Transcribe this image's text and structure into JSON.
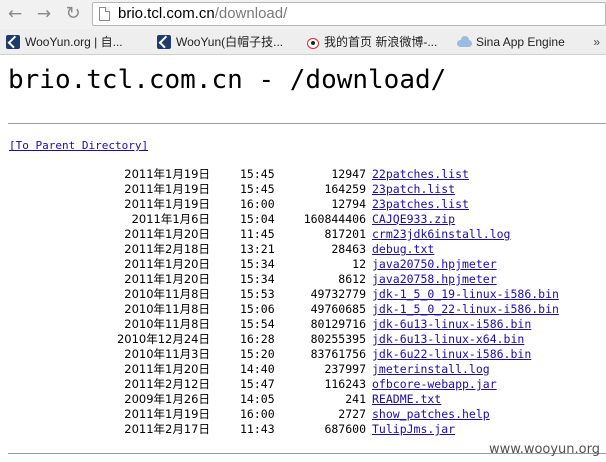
{
  "browser": {
    "url_host": "brio.tcl.com.cn",
    "url_path": "/download/",
    "back_icon": "arrow-left",
    "forward_icon": "arrow-right",
    "reload_icon": "reload"
  },
  "bookmarks": [
    {
      "label": "WooYun.org | 自...",
      "icon": "wooyun-icon"
    },
    {
      "label": "WooYun(白帽子技...",
      "icon": "wooyun-icon"
    },
    {
      "label": "我的首页 新浪微博-...",
      "icon": "weibo-icon"
    },
    {
      "label": "Sina App Engine",
      "icon": "cloud-icon"
    }
  ],
  "bookmarks_more": "»",
  "page": {
    "title": "brio.tcl.com.cn - /download/",
    "parent_link": "[To Parent Directory]"
  },
  "files": [
    {
      "date": "2011年1月19日",
      "time": "15:45",
      "size": "12947",
      "name": "22patches.list"
    },
    {
      "date": "2011年1月19日",
      "time": "15:45",
      "size": "164259",
      "name": "23patch.list"
    },
    {
      "date": "2011年1月19日",
      "time": "16:00",
      "size": "12794",
      "name": "23patches.list"
    },
    {
      "date": "2011年1月6日",
      "time": "15:04",
      "size": "160844406",
      "name": "CAJQE933.zip"
    },
    {
      "date": "2011年1月20日",
      "time": "11:45",
      "size": "817201",
      "name": "crm23jdk6install.log"
    },
    {
      "date": "2011年2月18日",
      "time": "13:21",
      "size": "28463",
      "name": "debug.txt"
    },
    {
      "date": "2011年1月20日",
      "time": "15:34",
      "size": "12",
      "name": "java20750.hpjmeter"
    },
    {
      "date": "2011年1月20日",
      "time": "15:34",
      "size": "8612",
      "name": "java20758.hpjmeter"
    },
    {
      "date": "2010年11月8日",
      "time": "15:53",
      "size": "49732779",
      "name": "jdk-1_5_0_19-linux-i586.bin"
    },
    {
      "date": "2010年11月8日",
      "time": "15:06",
      "size": "49760685",
      "name": "jdk-1_5_0_22-linux-i586.bin"
    },
    {
      "date": "2010年11月8日",
      "time": "15:54",
      "size": "80129716",
      "name": "jdk-6u13-linux-i586.bin"
    },
    {
      "date": "2010年12月24日",
      "time": "16:28",
      "size": "80255395",
      "name": "jdk-6u13-linux-x64.bin"
    },
    {
      "date": "2010年11月3日",
      "time": "15:20",
      "size": "83761756",
      "name": "jdk-6u22-linux-i586.bin"
    },
    {
      "date": "2011年1月20日",
      "time": "14:40",
      "size": "237997",
      "name": "jmeterinstall.log"
    },
    {
      "date": "2011年2月12日",
      "time": "15:47",
      "size": "116243",
      "name": "ofbcore-webapp.jar"
    },
    {
      "date": "2009年1月26日",
      "time": "14:05",
      "size": "241",
      "name": "README.txt"
    },
    {
      "date": "2011年1月19日",
      "time": "16:00",
      "size": "2727",
      "name": "show_patches.help"
    },
    {
      "date": "2011年2月17日",
      "time": "11:43",
      "size": "687600",
      "name": "TulipJms.jar"
    }
  ],
  "watermark": "www.wooyun.org"
}
